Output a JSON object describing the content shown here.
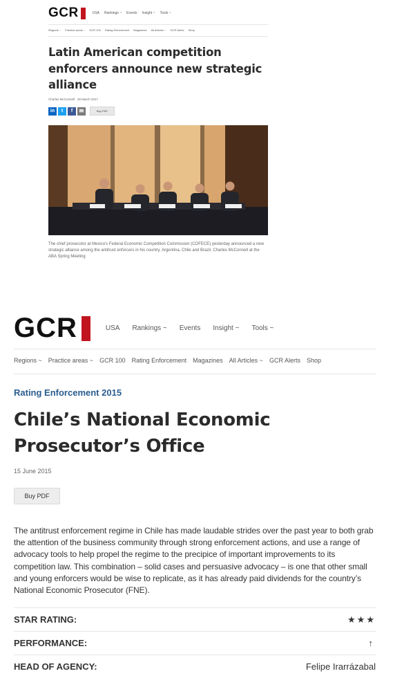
{
  "top_page": {
    "logo": "GCR",
    "nav_primary": [
      "USA",
      "Rankings ~",
      "Events",
      "Insight ~",
      "Tools ~"
    ],
    "nav_secondary": [
      "Regions ~",
      "Practice areas ~",
      "GCR 100",
      "Rating Enforcement",
      "Magazines",
      "All Articles ~",
      "GCR Alerts",
      "Shop"
    ],
    "headline": "Latin American competition enforcers announce new strategic alliance",
    "byline": "Charles McConnell · 30 March 2017",
    "share_icons": [
      "linkedin-icon",
      "twitter-icon",
      "facebook-icon",
      "email-icon"
    ],
    "share_labels": [
      "in",
      "t",
      "f",
      "✉"
    ],
    "buy_pdf": "Buy PDF",
    "caption": "The chief prosecutor at Mexico's Federal Economic Competition Commission (COFECE) yesterday announced a new strategic alliance among the antitrust enforcers in his country, Argentina, Chile and Brazil. Charles McConnell at the ABA Spring Meeting",
    "colors": {
      "linkedin": "#0a66c2",
      "twitter": "#1da1f2",
      "facebook": "#3b5998",
      "email": "#7a7a7a"
    }
  },
  "bottom_page": {
    "logo": "GCR",
    "nav_primary": [
      "USA",
      "Rankings ~",
      "Events",
      "Insight ~",
      "Tools ~"
    ],
    "nav_secondary": [
      "Regions ~",
      "Practice areas ~",
      "GCR 100",
      "Rating Enforcement",
      "Magazines",
      "All Articles ~",
      "GCR Alerts",
      "Shop"
    ],
    "section": "Rating Enforcement 2015",
    "title": "Chile’s National Economic Prosecutor’s Office",
    "date": "15 June 2015",
    "buy_pdf": "Buy PDF",
    "intro": "The antitrust enforcement regime in Chile has made laudable strides over the past year to both grab the attention of the business community through strong enforcement actions, and use a range of advocacy tools to help propel the regime to the precipice of important improvements to its competition law. This combination – solid cases and persuasive advocacy – is one that other small and young enforcers would be wise to replicate, as it has already paid dividends for the country’s National Economic Prosecutor (FNE).",
    "facts": [
      {
        "label": "STAR RATING:",
        "value": "★★★",
        "stars": 3
      },
      {
        "label": "PERFORMANCE:",
        "value": "↑",
        "trend": "up"
      },
      {
        "label": "HEAD OF AGENCY:",
        "value": "Felipe Irarrázabal"
      }
    ],
    "colors": {
      "brand_red": "#c0151f",
      "section_blue": "#2a5d8e",
      "star_red": "#a61e24"
    }
  }
}
